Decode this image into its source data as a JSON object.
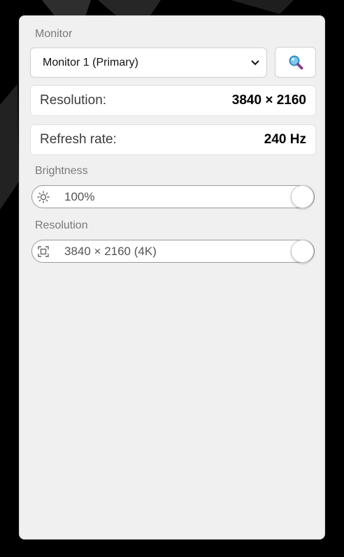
{
  "monitor": {
    "section_label": "Monitor",
    "selected_option": "Monitor 1 (Primary)",
    "identify_icon": "magnifier-icon"
  },
  "info": {
    "resolution_key": "Resolution:",
    "resolution_value": "3840 × 2160",
    "refresh_key": "Refresh rate:",
    "refresh_value": "240 Hz"
  },
  "brightness": {
    "section_label": "Brightness",
    "value_text": "100%",
    "level": 1.0,
    "icon": "sun-icon"
  },
  "resolution_slider": {
    "section_label": "Resolution",
    "value_text": "3840 × 2160 (4K)",
    "level": 1.0,
    "icon": "fullscreen-icon"
  },
  "colors": {
    "panel_bg": "#f0f0f0",
    "card_bg": "#ffffff",
    "label_gray": "#7a7a7a",
    "magnifier_blue": "#3fa9dc",
    "magnifier_handle": "#8a3f8a"
  }
}
